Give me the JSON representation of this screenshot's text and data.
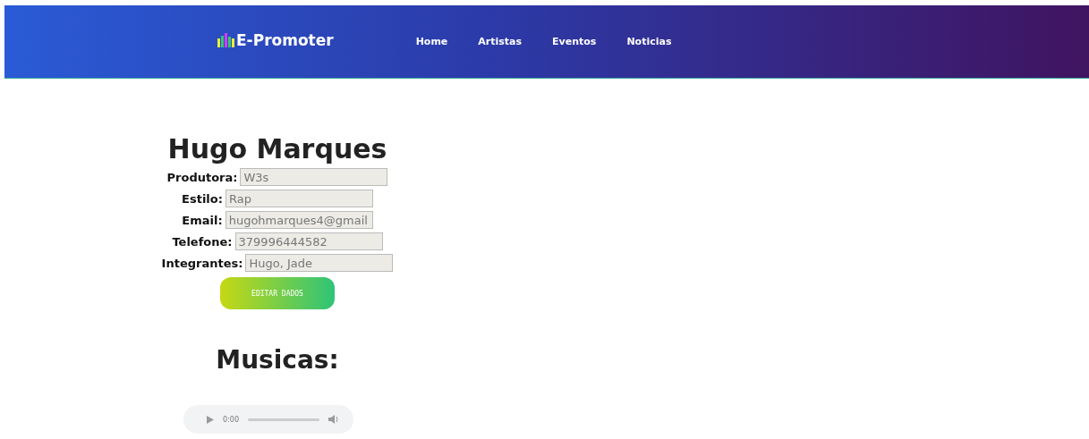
{
  "header": {
    "logo": "E-Promoter",
    "nav": [
      {
        "label": "Home"
      },
      {
        "label": "Artistas"
      },
      {
        "label": "Eventos"
      },
      {
        "label": "Noticias"
      }
    ]
  },
  "profile": {
    "name": "Hugo Marques",
    "fields": [
      {
        "label": "Produtora:",
        "value": "W3s"
      },
      {
        "label": "Estilo:",
        "value": "Rap"
      },
      {
        "label": "Email:",
        "value": "hugohmarques4@gmail"
      },
      {
        "label": "Telefone:",
        "value": "379996444582"
      },
      {
        "label": "Integrantes:",
        "value": "Hugo, Jade"
      }
    ],
    "edit_button": "EDITAR DADOS"
  },
  "music": {
    "heading": "Musicas:",
    "player": {
      "time": "0:00"
    }
  }
}
